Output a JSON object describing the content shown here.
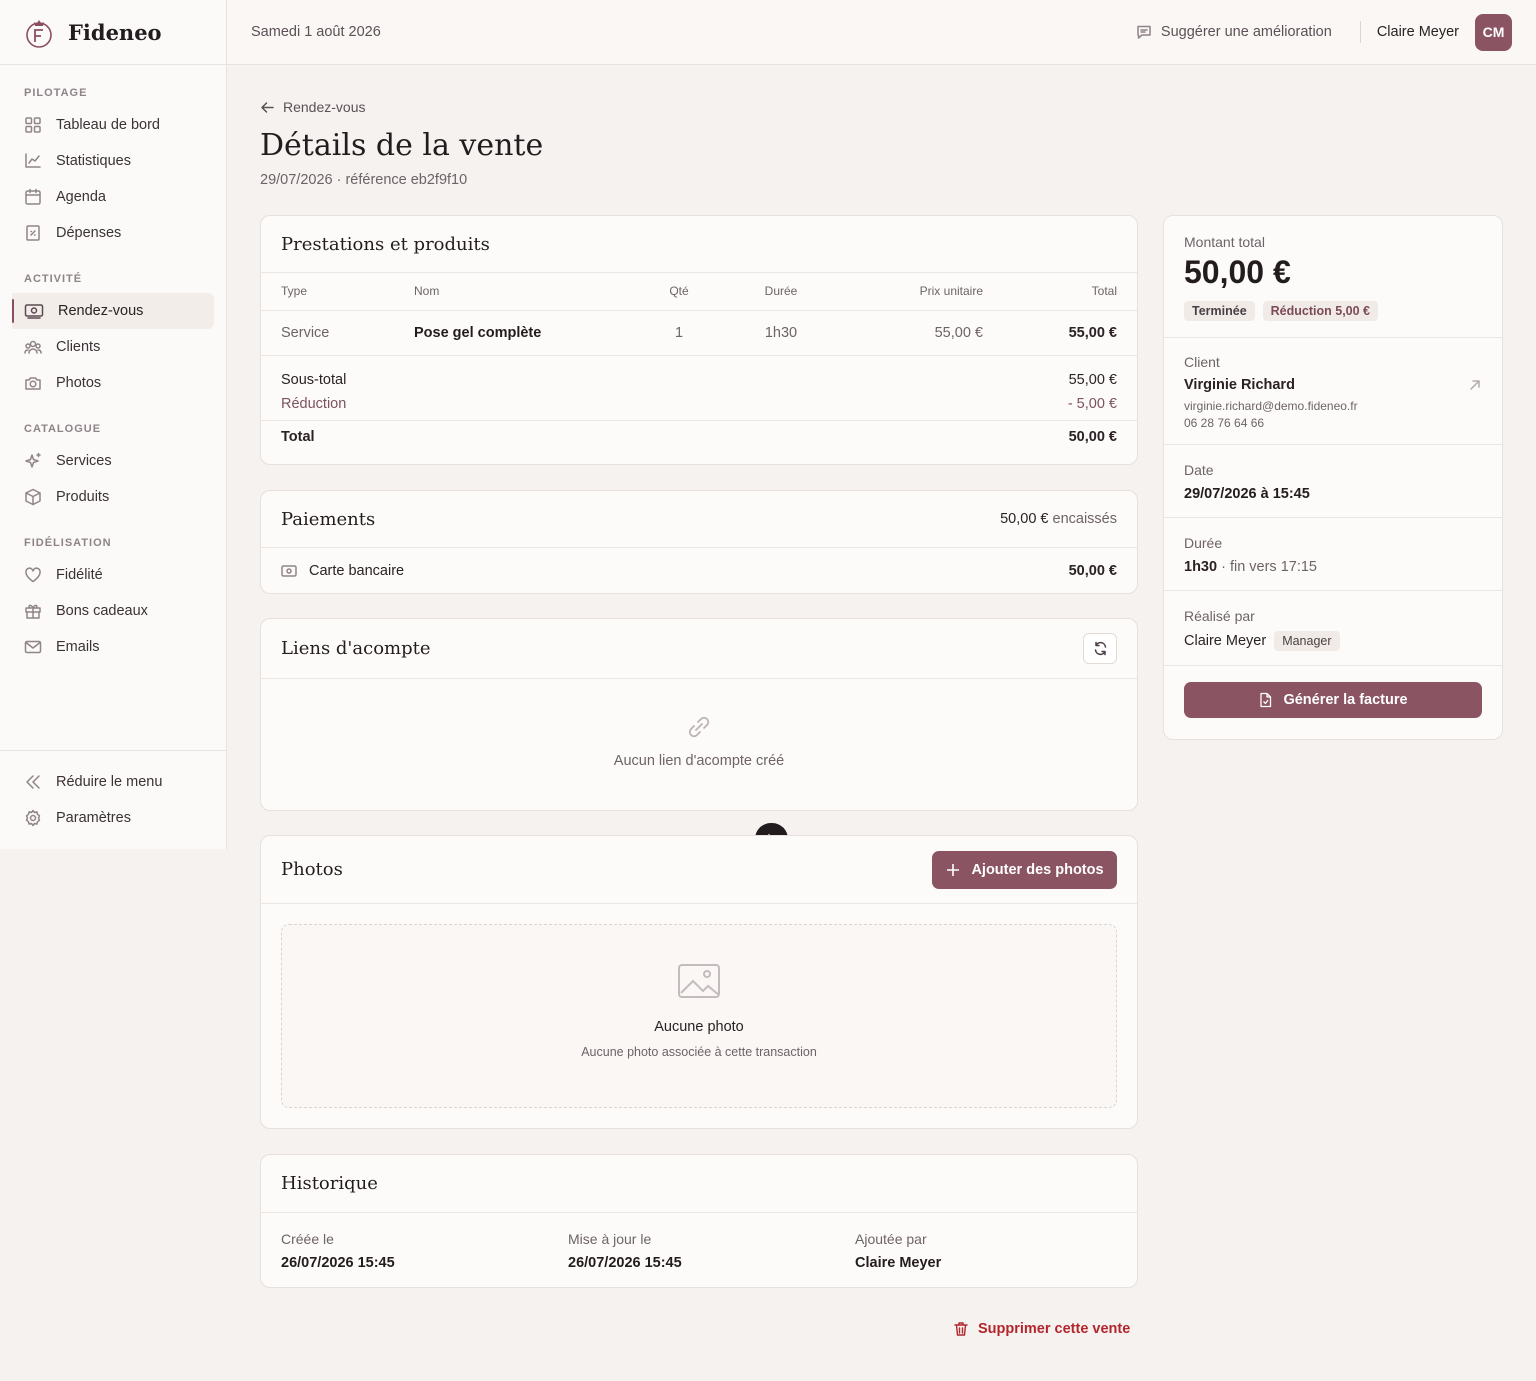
{
  "app": {
    "name": "Fideneo"
  },
  "header": {
    "date": "Samedi 1 août 2026",
    "suggest": "Suggérer une amélioration",
    "user_name": "Claire Meyer",
    "avatar": "CM"
  },
  "sidebar": {
    "sections": [
      {
        "label": "PILOTAGE",
        "items": [
          {
            "label": "Tableau de bord",
            "icon": "grid-icon"
          },
          {
            "label": "Statistiques",
            "icon": "chart-icon"
          },
          {
            "label": "Agenda",
            "icon": "calendar-icon"
          },
          {
            "label": "Dépenses",
            "icon": "receipt-icon"
          }
        ]
      },
      {
        "label": "ACTIVITÉ",
        "items": [
          {
            "label": "Rendez-vous",
            "icon": "cash-icon"
          },
          {
            "label": "Clients",
            "icon": "users-icon"
          },
          {
            "label": "Photos",
            "icon": "camera-icon"
          }
        ]
      },
      {
        "label": "CATALOGUE",
        "items": [
          {
            "label": "Services",
            "icon": "sparkles-icon"
          },
          {
            "label": "Produits",
            "icon": "box-icon"
          }
        ]
      },
      {
        "label": "FIDÉLISATION",
        "items": [
          {
            "label": "Fidélité",
            "icon": "heart-icon"
          },
          {
            "label": "Bons cadeaux",
            "icon": "gift-icon"
          },
          {
            "label": "Emails",
            "icon": "mail-icon"
          }
        ]
      }
    ],
    "collapse": "Réduire le menu",
    "settings": "Paramètres"
  },
  "page": {
    "back": "Rendez-vous",
    "title": "Détails de la vente",
    "subtitle": "29/07/2026 · référence eb2f9f10"
  },
  "items_card": {
    "title": "Prestations et produits",
    "columns": [
      "Type",
      "Nom",
      "Qté",
      "Durée",
      "Prix unitaire",
      "Total"
    ],
    "rows": [
      [
        "Service",
        "Pose gel complète",
        "1",
        "1h30",
        "55,00 €",
        "55,00 €"
      ]
    ],
    "subtotal_label": "Sous-total",
    "subtotal": "55,00 €",
    "discount_label": "Réduction",
    "discount": "- 5,00 €",
    "total_label": "Total",
    "total": "50,00 €"
  },
  "payments": {
    "title": "Paiements",
    "collected_amount": "50,00 €",
    "collected_label": "encaissés",
    "method": "Carte bancaire",
    "amount": "50,00 €"
  },
  "deposit": {
    "title": "Liens d'acompte",
    "empty": "Aucun lien d'acompte créé"
  },
  "photos": {
    "title": "Photos",
    "add": "Ajouter des photos",
    "empty_title": "Aucune photo",
    "empty_text": "Aucune photo associée à cette transaction"
  },
  "history": {
    "title": "Historique",
    "created_label": "Créée le",
    "created": "26/07/2026 15:45",
    "updated_label": "Mise à jour le",
    "updated": "26/07/2026 15:45",
    "by_label": "Ajoutée par",
    "by": "Claire Meyer"
  },
  "delete": "Supprimer cette vente",
  "summary": {
    "total_label": "Montant total",
    "total": "50,00 €",
    "status": "Terminée",
    "discount_chip": "Réduction 5,00 €",
    "client_label": "Client",
    "client_name": "Virginie Richard",
    "client_email": "virginie.richard@demo.fideneo.fr",
    "client_phone": "06 28 76 64 66",
    "date_label": "Date",
    "date": "29/07/2026 à 15:45",
    "duration_label": "Durée",
    "duration": "1h30",
    "duration_end": "· fin vers 17:15",
    "by_label": "Réalisé par",
    "by": "Claire Meyer",
    "role": "Manager",
    "invoice": "Générer la facture"
  },
  "colors": {
    "accent": "#8a5462",
    "danger": "#b3262d"
  }
}
